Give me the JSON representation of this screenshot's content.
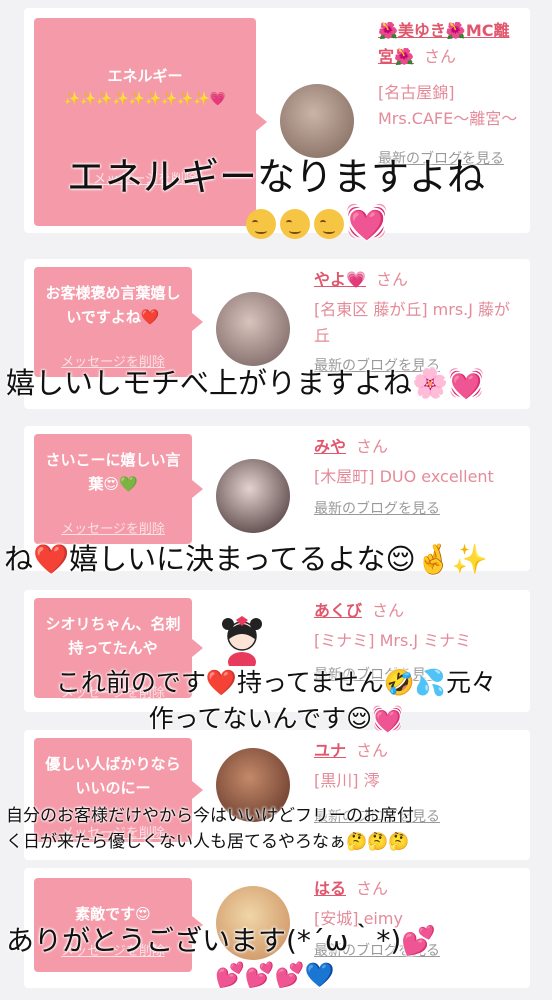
{
  "cards": [
    {
      "message": "エネルギー",
      "message_emoji": "✨✨✨✨✨✨✨✨✨💗",
      "delete_label": "メッセージを削除",
      "name": "🌺美ゆき🌺MC離宮🌺",
      "honorific": "さん",
      "shop": "[名古屋錦] Mrs.CAFE〜離宮〜",
      "blog_label": "最新のブログを見る",
      "avatar_colors": [
        "#c9b5a8",
        "#7d6256"
      ]
    },
    {
      "message": "お客様褒め言葉嬉しいですよね❤️",
      "delete_label": "メッセージを削除",
      "name": "やよ💗",
      "honorific": "さん",
      "shop": "[名東区 藤が丘] mrs.J 藤が丘",
      "blog_label": "最新のブログを見る",
      "avatar_colors": [
        "#d9c3bd",
        "#6e5a58"
      ]
    },
    {
      "message": "さいこーに嬉しい言葉😍💚",
      "delete_label": "メッセージを削除",
      "name": "みや",
      "honorific": "さん",
      "shop": "[木屋町] DUO excellent",
      "blog_label": "最新のブログを見る",
      "avatar_colors": [
        "#e3d2cf",
        "#3b2a2a"
      ]
    },
    {
      "message": "シオリちゃん、名刺持ってたんや",
      "delete_label": "メッセージを削除",
      "name": "あくび",
      "honorific": "さん",
      "shop": "[ミナミ] Mrs.J ミナミ",
      "blog_label": "最新のブログを見る"
    },
    {
      "message": "優しい人ばかりならいいのにー",
      "delete_label": "メッセージを削除",
      "name": "ユナ",
      "honorific": "さん",
      "shop": "[黒川] 澪",
      "blog_label": "最新のブログを見る",
      "avatar_colors": [
        "#c48a6a",
        "#5b2e22"
      ]
    },
    {
      "message": "素敵です😍",
      "delete_label": "メッセージを削除",
      "name": "はる",
      "honorific": "さん",
      "shop": "[安城] eimy",
      "blog_label": "最新のブログを見る",
      "avatar_colors": [
        "#f0d6a8",
        "#c98a5a"
      ]
    }
  ],
  "overlays": {
    "o1_line1": "エネルギーなりますよね",
    "o1_line2": "💓",
    "o2": "嬉しいしモチべ上がりますよね🌸💓",
    "o3": "ね❤️嬉しいに決まってるよな😌🤞✨",
    "o4_line1": "これ前のです❤️持ってません🤣💦元々",
    "o4_line2": "作ってないんです😌💓",
    "o5_line1": "自分のお客様だけやから今はいいけどフリーのお席付",
    "o5_line2": "く日が来たら優しくない人も居てるやろなぁ🤔🤔🤔",
    "o6_line1": "ありがとうございます(*´ω｀*)💕",
    "o6_line2": "💕💕💕💙"
  },
  "colors": {
    "bubble": "#f49aa8",
    "name": "#e0566c",
    "shop": "#e48b99"
  }
}
